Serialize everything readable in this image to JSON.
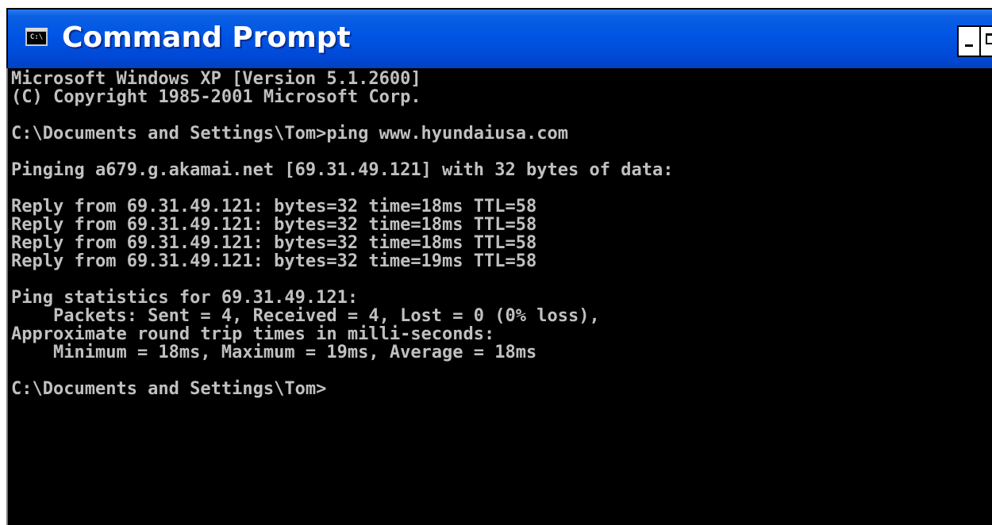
{
  "window": {
    "title": "Command Prompt",
    "icon": "console-app-icon",
    "icon_text": "C:\\"
  },
  "console": {
    "lines": [
      "Microsoft Windows XP [Version 5.1.2600]",
      "(C) Copyright 1985-2001 Microsoft Corp.",
      "C:\\Documents and Settings\\Tom>ping www.hyundaiusa.com",
      "Pinging a679.g.akamai.net [69.31.49.121] with 32 bytes of data:",
      "Reply from 69.31.49.121: bytes=32 time=18ms TTL=58",
      "Reply from 69.31.49.121: bytes=32 time=18ms TTL=58",
      "Reply from 69.31.49.121: bytes=32 time=18ms TTL=58",
      "Reply from 69.31.49.121: bytes=32 time=19ms TTL=58",
      "Ping statistics for 69.31.49.121:",
      "    Packets: Sent = 4, Received = 4, Lost = 0 (0% loss),",
      "Approximate round trip times in milli-seconds:",
      "    Minimum = 18ms, Maximum = 19ms, Average = 18ms",
      "C:\\Documents and Settings\\Tom>"
    ]
  },
  "colors": {
    "titlebar": "#0055e5",
    "console_background": "#000000",
    "console_text": "#c0c0c0",
    "title_text": "#ffffff"
  }
}
